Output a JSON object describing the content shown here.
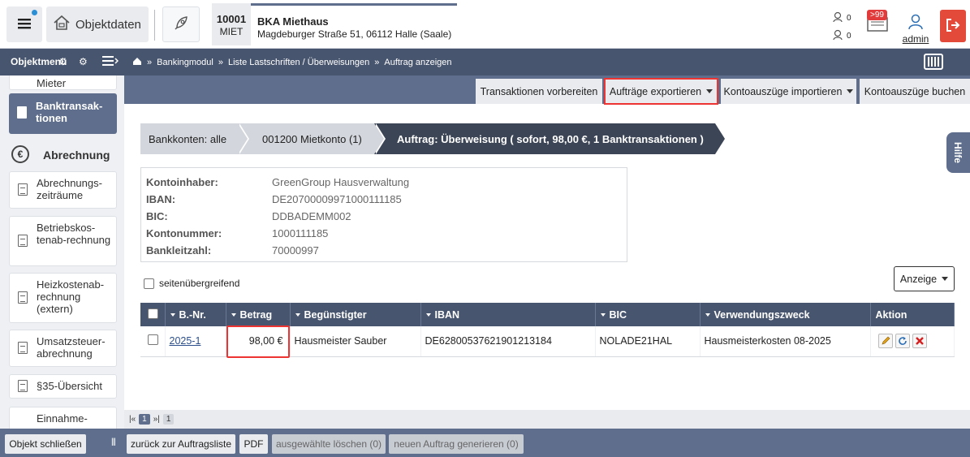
{
  "header": {
    "objektdaten_label": "Objektdaten",
    "object_id": "10001",
    "object_type": "MIET",
    "object_name": "BKA Miethaus",
    "object_address": "Magdeburger Straße 51, 06112 Halle (Saale)",
    "notif_1_count": "0",
    "notif_2_count": "0",
    "messages_badge": ">99",
    "user_label": "admin"
  },
  "navbar": {
    "menu_title": "Objektmenü",
    "breadcrumb": [
      "Bankingmodul",
      "Liste Lastschriften / Überweisungen",
      "Auftrag anzeigen"
    ]
  },
  "sidebar": {
    "cut_item": "Mieter",
    "active_item": "Banktransak-tionen",
    "section_title": "Abrechnung",
    "items": [
      "Abrechnungs-zeiträume",
      "Betriebskos-tenab-rechnung",
      "Heizkostenab-rechnung (extern)",
      "Umsatzsteuer-abrechnung",
      "§35-Übersicht",
      "Einnahme-"
    ]
  },
  "actionbar": {
    "btn_transaktionen": "Transaktionen vorbereiten",
    "btn_exportieren": "Aufträge exportieren",
    "btn_importieren": "Kontoauszüge importieren",
    "btn_buchen": "Kontoauszüge buchen"
  },
  "crumbs": {
    "c1": "Bankkonten: alle",
    "c2": "001200 Mietkonto (1)",
    "c3": "Auftrag: Überweisung ( sofort, 98,00 €, 1 Banktransaktionen )"
  },
  "account": {
    "labels": {
      "inhaber": "Kontoinhaber:",
      "iban": "IBAN:",
      "bic": "BIC:",
      "kontonummer": "Kontonummer:",
      "blz": "Bankleitzahl:"
    },
    "values": {
      "inhaber": "GreenGroup Hausverwaltung",
      "iban": "DE20700009971000111185",
      "bic": "DDBADEMM002",
      "kontonummer": "1000111185",
      "blz": "70000997"
    }
  },
  "options": {
    "seitenuebergreifend": "seitenübergreifend",
    "anzeige": "Anzeige"
  },
  "table": {
    "headers": [
      "B.-Nr.",
      "Betrag",
      "Begünstigter",
      "IBAN",
      "BIC",
      "Verwendungszweck",
      "Aktion"
    ],
    "rows": [
      {
        "bnr": "2025-1",
        "betrag": "98,00 €",
        "beguenstigter": "Hausmeister Sauber",
        "iban": "DE62800537621901213184",
        "bic": "NOLADE21HAL",
        "zweck": "Hausmeisterkosten 08-2025"
      }
    ]
  },
  "pager": {
    "first": "|«",
    "current": "1",
    "last": "»|",
    "page_select": "1"
  },
  "hilfe": "Hilfe",
  "bottombar": {
    "close": "Objekt schließen",
    "back": "zurück zur Auftragsliste",
    "pdf": "PDF",
    "delete": "ausgewählte löschen (0)",
    "new_order": "neuen Auftrag generieren (0)"
  },
  "colors": {
    "nav_dark": "#48556e",
    "nav_mid": "#5e6e8c",
    "highlight_red": "#e33333",
    "logout_red": "#e44a3a"
  }
}
